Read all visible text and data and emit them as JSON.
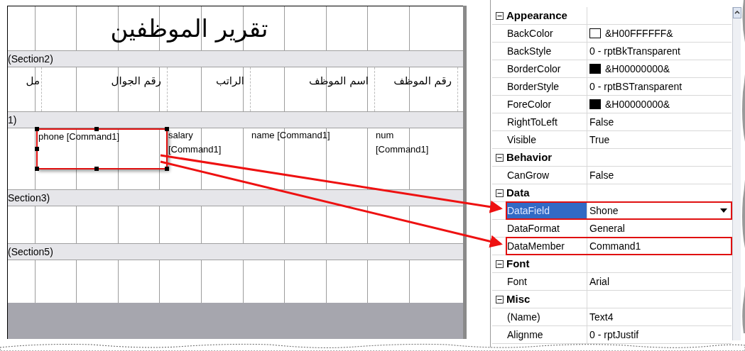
{
  "designer": {
    "title": "تقرير الموظفين",
    "page_header_band": "(Section2)",
    "column_headers": [
      "رقم الموظف",
      "اسم الموظف",
      "الراتب",
      "رقم الجوال",
      "مل"
    ],
    "detail_band": "1)",
    "detail_fields": [
      {
        "text": "phone [Command1]",
        "selected": true
      },
      {
        "text": "salary [Command1]",
        "selected": false
      },
      {
        "text": "name [Command1]",
        "selected": false
      },
      {
        "text": "num [Command1]",
        "selected": false
      }
    ],
    "page_footer_band": "Section3)",
    "report_footer_band": "(Section5)"
  },
  "properties": [
    {
      "kind": "category",
      "name": "Appearance",
      "expanded": true
    },
    {
      "kind": "property",
      "name": "BackColor",
      "value": "&H00FFFFFF&",
      "color": "#ffffff",
      "selected": false,
      "annotated": false
    },
    {
      "kind": "property",
      "name": "BackStyle",
      "value": "0 - rptBkTransparent",
      "selected": false,
      "annotated": false
    },
    {
      "kind": "property",
      "name": "BorderColor",
      "value": "&H00000000&",
      "color": "#000000",
      "selected": false,
      "annotated": false
    },
    {
      "kind": "property",
      "name": "BorderStyle",
      "value": "0 - rptBSTransparent",
      "selected": false,
      "annotated": false
    },
    {
      "kind": "property",
      "name": "ForeColor",
      "value": "&H00000000&",
      "color": "#000000",
      "selected": false,
      "annotated": false
    },
    {
      "kind": "property",
      "name": "RightToLeft",
      "value": "False",
      "selected": false,
      "annotated": false
    },
    {
      "kind": "property",
      "name": "Visible",
      "value": "True",
      "selected": false,
      "annotated": false
    },
    {
      "kind": "category",
      "name": "Behavior",
      "expanded": true
    },
    {
      "kind": "property",
      "name": "CanGrow",
      "value": "False",
      "selected": false,
      "annotated": false
    },
    {
      "kind": "category",
      "name": "Data",
      "expanded": true
    },
    {
      "kind": "property",
      "name": "DataField",
      "value": "Shone",
      "selected": true,
      "annotated": true,
      "dropdown": true
    },
    {
      "kind": "property",
      "name": "DataFormat",
      "value": "General",
      "selected": false,
      "annotated": false
    },
    {
      "kind": "property",
      "name": "DataMember",
      "value": "Command1",
      "selected": false,
      "annotated": true
    },
    {
      "kind": "category",
      "name": "Font",
      "expanded": true
    },
    {
      "kind": "property",
      "name": "Font",
      "value": "Arial",
      "selected": false,
      "annotated": false
    },
    {
      "kind": "category",
      "name": "Misc",
      "expanded": true
    },
    {
      "kind": "property",
      "name": "(Name)",
      "value": "Text4",
      "selected": false,
      "annotated": false
    },
    {
      "kind": "property",
      "name": "Alignme",
      "value": "0 - rptJustif",
      "selected": false,
      "annotated": false
    }
  ]
}
